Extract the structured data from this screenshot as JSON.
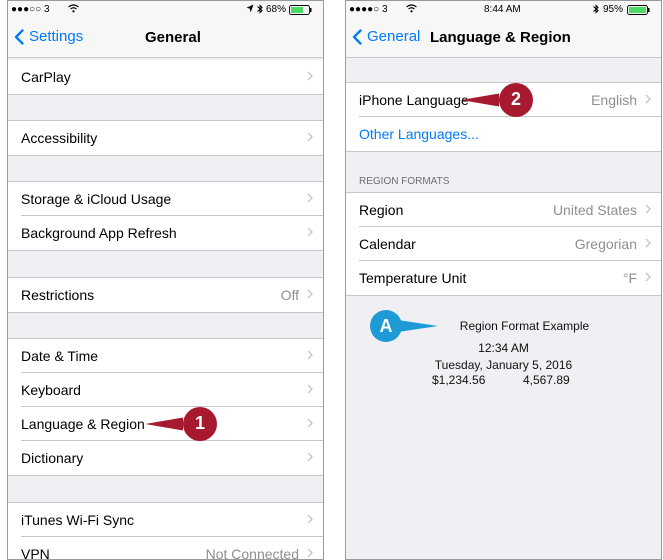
{
  "left_screen": {
    "status": {
      "carrier": "●●●○○ 3",
      "battery": "68%"
    },
    "nav": {
      "back_label": "Settings",
      "title": "General"
    },
    "rows": {
      "carplay": {
        "label": "CarPlay"
      },
      "accessibility": {
        "label": "Accessibility"
      },
      "storage": {
        "label": "Storage & iCloud Usage"
      },
      "background_refresh": {
        "label": "Background App Refresh"
      },
      "restrictions": {
        "label": "Restrictions",
        "value": "Off"
      },
      "date_time": {
        "label": "Date & Time"
      },
      "keyboard": {
        "label": "Keyboard"
      },
      "language_region": {
        "label": "Language & Region"
      },
      "dictionary": {
        "label": "Dictionary"
      },
      "itunes_sync": {
        "label": "iTunes Wi-Fi Sync"
      },
      "vpn": {
        "label": "VPN",
        "value": "Not Connected"
      }
    },
    "callout": "1"
  },
  "right_screen": {
    "status": {
      "carrier": "●●●●○ 3",
      "time": "8:44 AM",
      "battery": "95%"
    },
    "nav": {
      "back_label": "General",
      "title": "Language & Region"
    },
    "rows": {
      "iphone_language": {
        "label": "iPhone Language",
        "value": "English"
      },
      "other_languages": {
        "label": "Other Languages..."
      },
      "region": {
        "label": "Region",
        "value": "United States"
      },
      "calendar": {
        "label": "Calendar",
        "value": "Gregorian"
      },
      "temperature": {
        "label": "Temperature Unit",
        "value": "°F"
      }
    },
    "section_header": "REGION FORMATS",
    "example": {
      "title": "Region Format Example",
      "time": "12:34 AM",
      "date": "Tuesday, January 5, 2016",
      "currency": "$1,234.56",
      "number": "4,567.89"
    },
    "callout_2": "2",
    "callout_a": "A"
  },
  "colors": {
    "accent": "#007aff",
    "callout": "#a6192e",
    "callout_a": "#1e9bd7",
    "group_bg": "#efeff4"
  }
}
